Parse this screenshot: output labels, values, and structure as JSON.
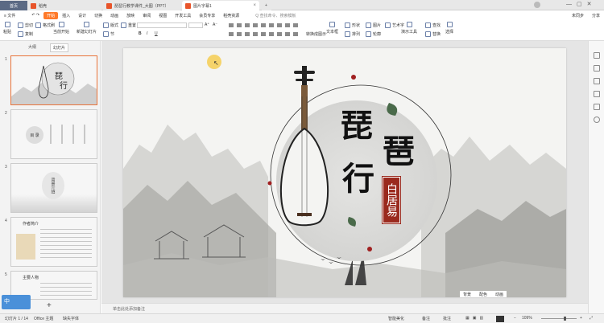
{
  "titlebar": {
    "home": "首页",
    "tabs": [
      {
        "label": "稻壳"
      },
      {
        "label": "琵琶行教学课件_大图（PPT）"
      },
      {
        "label": "图片字幕1"
      }
    ],
    "new_tab": "+"
  },
  "menubar": {
    "file": "≡ 文件",
    "items": [
      "开始",
      "插入",
      "设计",
      "切换",
      "动画",
      "放映",
      "审阅",
      "视图",
      "开发工具",
      "会员专享",
      "稻壳资源"
    ],
    "active": "开始",
    "search": "Q 查找命令、搜索模板",
    "share": "分享",
    "unsync": "未同步"
  },
  "ribbon": {
    "paste": "粘贴",
    "format_painter": "格式刷",
    "cut": "剪切",
    "copy": "复制",
    "from_current": "当前开始",
    "new_slide": "新建幻灯片",
    "layout": "版式",
    "section": "节",
    "reset": "重置",
    "font_size_up": "A⁺",
    "font_size_down": "A⁻",
    "bold": "B",
    "italic": "I",
    "underline": "U",
    "text_box": "文本框",
    "shape": "形状",
    "arrange": "排列",
    "outline": "轮廓",
    "picture": "图片",
    "textbox2": "艺术字",
    "smart_tools": "演示工具",
    "find": "查找",
    "replace": "替换",
    "select": "选择",
    "convert": "转换成图示"
  },
  "leftpanel": {
    "tabs": [
      "大纲",
      "幻灯片"
    ],
    "active_tab": "幻灯片",
    "thumbs": [
      {
        "num": "1"
      },
      {
        "num": "2",
        "text": "目 录"
      },
      {
        "num": "3",
        "text": "背景介绍"
      },
      {
        "num": "4",
        "text": "作者简介"
      },
      {
        "num": "5",
        "text": "主要人物"
      }
    ],
    "add": "+",
    "ime": "中"
  },
  "slide": {
    "title_char1": "琵",
    "title_char2": "琶",
    "title_char3": "行",
    "author": "白居易"
  },
  "notes": {
    "placeholder": "单击此处添加备注"
  },
  "statusbar": {
    "page": "幻灯片 1 / 14",
    "theme": "Office 主题",
    "missing_font": "缺失字体",
    "smart": "智能美化",
    "notes": "备注",
    "comments": "批注",
    "zoom": "109%",
    "slide_tools": [
      "背景",
      "配色",
      "动画"
    ]
  }
}
